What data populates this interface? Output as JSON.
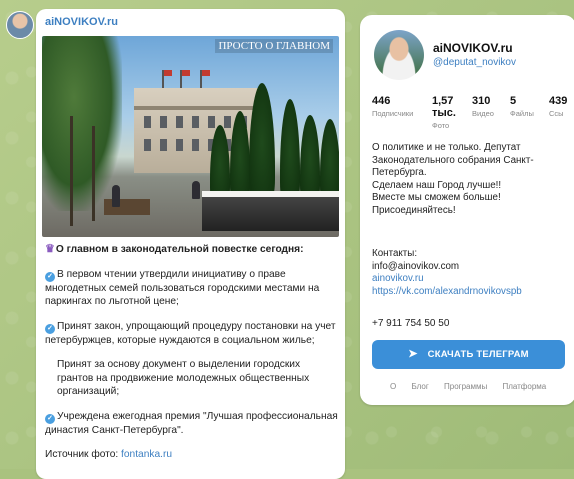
{
  "post": {
    "channel": "aiNOVIKOV.ru",
    "photo_caption": "ПРОСТО О ГЛАВНОМ",
    "heading": "О главном в законодательной повестке сегодня:",
    "items": [
      "В первом чтении утвердили инициативу о праве многодетных семей пользоваться городскими местами на паркингах по льготной цене;",
      "Принят закон, упрощающий процедуру постановки на учет петербуржцев, которые нуждаются в социальном жилье;",
      "Принят за основу документ о выделении городских грантов на продвижение молодежных общественных организаций;",
      "Учреждена ежегодная премия \"Лучшая профессиональная династия Санкт-Петербурга\"."
    ],
    "source_label": "Источник фото:",
    "source_link": "fontanka.ru"
  },
  "channel_info": {
    "name": "aiNOVIKOV.ru",
    "handle": "@deputat_novikov",
    "stats": [
      {
        "num": "446",
        "label": "Подписчики"
      },
      {
        "num": "1,57 тыс.",
        "label": "Фото"
      },
      {
        "num": "310",
        "label": "Видео"
      },
      {
        "num": "5",
        "label": "Файлы"
      },
      {
        "num": "439",
        "label": "Ссы"
      }
    ],
    "description": [
      "О политике и не только. Депутат Законодательного собрания Санкт-Петербурга.",
      "Сделаем наш Город лучше!!",
      "Вместе мы сможем больше!",
      "Присоединяйтесь!"
    ],
    "contacts_label": "Контакты:",
    "email": "info@ainovikov.com",
    "site": "ainovikov.ru",
    "vk": "https://vk.com/alexandrnovikovspb",
    "phone": "+7 911 754 50 50",
    "download_label": "СКАЧАТЬ ТЕЛЕГРАМ",
    "footer_links": [
      "О",
      "Блог",
      "Программы",
      "Платформа"
    ]
  },
  "colors": {
    "accent": "#3b8fd8",
    "link": "#3d7fc1",
    "background": "#a9c27f"
  },
  "icons": [
    "check-icon",
    "crown-icon",
    "telegram-plane-icon"
  ]
}
